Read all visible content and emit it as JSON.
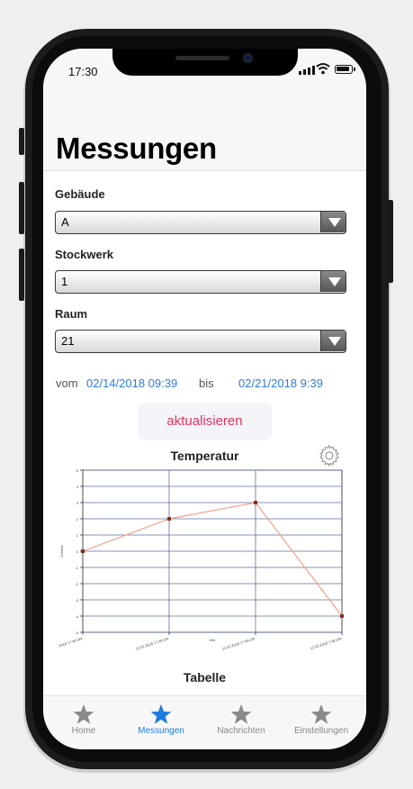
{
  "status": {
    "time": "17:30"
  },
  "header": {
    "title": "Messungen"
  },
  "form": {
    "building": {
      "label": "Gebäude",
      "value": "A"
    },
    "floor": {
      "label": "Stockwerk",
      "value": "1"
    },
    "room": {
      "label": "Raum",
      "value": "21"
    }
  },
  "range": {
    "from_label": "vom",
    "from_value": "02/14/2018 09:39",
    "to_label": "bis",
    "to_value": "02/21/2018 9:39"
  },
  "refresh_label": "aktualisieren",
  "chart_title": "Temperatur",
  "table_title": "Tabelle",
  "colors": {
    "accent": "#1e7be0",
    "link": "#2f7de1",
    "action": "#e0345c",
    "series_line": "#f5a08a",
    "series_marker": "#8b2e1e"
  },
  "chart_data": {
    "type": "line",
    "title": "Temperatur",
    "xlabel": "Zeit",
    "ylabel": "Celsius",
    "ylim": [
      -5,
      5
    ],
    "yticks": [
      5,
      4,
      3,
      2,
      1,
      0,
      -1,
      -2,
      -3,
      -4,
      -5
    ],
    "x": [
      "2018 17:49 Uhr",
      "12.02.2018 17:49 Uhr",
      "12.02.2018 17:49 Uhr",
      "12.02.2018 7:49 Uhr"
    ],
    "series": [
      {
        "values": [
          0,
          2,
          3,
          -4
        ]
      }
    ],
    "grid": true
  },
  "tabs": [
    {
      "label": "Home",
      "icon": "star-icon",
      "active": false
    },
    {
      "label": "Messungen",
      "icon": "star-icon",
      "active": true
    },
    {
      "label": "Nachrichten",
      "icon": "star-icon",
      "active": false
    },
    {
      "label": "Einstellungen",
      "icon": "star-icon",
      "active": false
    }
  ]
}
